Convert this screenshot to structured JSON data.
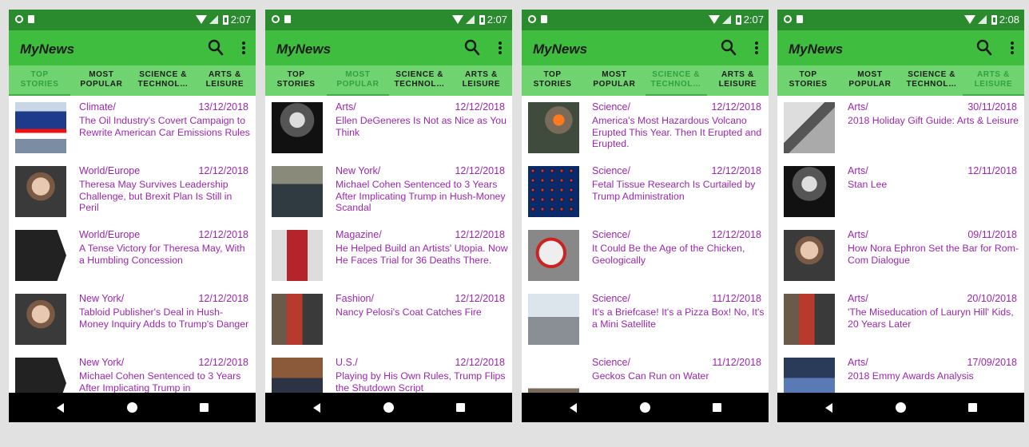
{
  "colors": {
    "status_bar": "#2a8a2e",
    "app_bar": "#3fbd3f",
    "tab_bar": "#6fd46f",
    "headline": "#9c27b0",
    "background": "#e1e1e1"
  },
  "screens": [
    {
      "time": "2:07",
      "app_title": "MyNews",
      "tabs": [
        "TOP\nSTORIES",
        "MOST\nPOPULAR",
        "SCIENCE &\nTECHNOL…",
        "ARTS &\nLEISURE"
      ],
      "active_tab": 0,
      "articles": [
        {
          "section": "Climate/",
          "date": "13/12/2018",
          "title": "The Oil Industry's Covert Campaign to Rewrite American Car Emissions Rules",
          "thumb": "marathon-logo"
        },
        {
          "section": "World/Europe",
          "date": "12/12/2018",
          "title": "Theresa May Survives Leadership Challenge, but Brexit Plan Is Still in Peril",
          "thumb": "portrait"
        },
        {
          "section": "World/Europe",
          "date": "12/12/2018",
          "title": "A Tense Victory for Theresa May, With a Humbling Concession",
          "thumb": "nyt-logo"
        },
        {
          "section": "New York/",
          "date": "12/12/2018",
          "title": "Tabloid Publisher's Deal in Hush-Money Inquiry Adds to Trump's Danger",
          "thumb": "portrait"
        },
        {
          "section": "New York/",
          "date": "12/12/2018",
          "title": "Michael Cohen Sentenced to 3 Years After Implicating Trump in",
          "thumb": "nyt-logo"
        }
      ]
    },
    {
      "time": "2:07",
      "app_title": "MyNews",
      "tabs": [
        "TOP\nSTORIES",
        "MOST\nPOPULAR",
        "SCIENCE &\nTECHNOL…",
        "ARTS &\nLEISURE"
      ],
      "active_tab": 1,
      "articles": [
        {
          "section": "Arts/",
          "date": "12/12/2018",
          "title": "Ellen DeGeneres Is Not as Nice as You Think",
          "thumb": "bw-photo"
        },
        {
          "section": "New York/",
          "date": "12/12/2018",
          "title": "Michael Cohen Sentenced to 3 Years After Implicating Trump in Hush-Money Scandal",
          "thumb": "crowd"
        },
        {
          "section": "Magazine/",
          "date": "12/12/2018",
          "title": "He Helped Build an Artists' Utopia. Now He Faces Trial for 36 Deaths There.",
          "thumb": "red-figure"
        },
        {
          "section": "Fashion/",
          "date": "12/12/2018",
          "title": "Nancy Pelosi's Coat Catches Fire",
          "thumb": "people"
        },
        {
          "section": "U.S./",
          "date": "12/12/2018",
          "title": "Playing by His Own Rules, Trump Flips the Shutdown Script",
          "thumb": "office"
        }
      ]
    },
    {
      "time": "2:07",
      "app_title": "MyNews",
      "tabs": [
        "TOP\nSTORIES",
        "MOST\nPOPULAR",
        "SCIENCE &\nTECHNOL…",
        "ARTS &\nLEISURE"
      ],
      "active_tab": 2,
      "articles": [
        {
          "section": "Science/",
          "date": "12/12/2018",
          "title": "America's Most Hazardous Volcano Erupted This Year. Then It Erupted and Erupted.",
          "thumb": "volcano"
        },
        {
          "section": "Science/",
          "date": "12/12/2018",
          "title": "Fetal Tissue Research Is Curtailed by Trump Administration",
          "thumb": "cells"
        },
        {
          "section": "Science/",
          "date": "12/12/2018",
          "title": "It Could Be the Age of the Chicken, Geologically",
          "thumb": "chicken"
        },
        {
          "section": "Science/",
          "date": "11/12/2018",
          "title": "It's a Briefcase! It's a Pizza Box! No, It's a Mini Satellite",
          "thumb": "lab"
        },
        {
          "section": "Science/",
          "date": "11/12/2018",
          "title": "Geckos Can Run on Water",
          "thumb": "water"
        }
      ]
    },
    {
      "time": "2:08",
      "app_title": "MyNews",
      "tabs": [
        "TOP\nSTORIES",
        "MOST\nPOPULAR",
        "SCIENCE &\nTECHNOL…",
        "ARTS &\nLEISURE"
      ],
      "active_tab": 3,
      "articles": [
        {
          "section": "Arts/",
          "date": "30/11/2018",
          "title": "2018 Holiday Gift Guide: Arts & Leisure",
          "thumb": "books"
        },
        {
          "section": "Arts/",
          "date": "12/11/2018",
          "title": "Stan Lee",
          "thumb": "bw-photo"
        },
        {
          "section": "Arts/",
          "date": "09/11/2018",
          "title": "How Nora Ephron Set the Bar for Rom-Com Dialogue",
          "thumb": "portrait"
        },
        {
          "section": "Arts/",
          "date": "20/10/2018",
          "title": "'The Miseducation of Lauryn Hill' Kids, 20 Years Later",
          "thumb": "people"
        },
        {
          "section": "Arts/",
          "date": "17/09/2018",
          "title": "2018 Emmy Awards Analysis",
          "thumb": "stage"
        }
      ]
    }
  ]
}
